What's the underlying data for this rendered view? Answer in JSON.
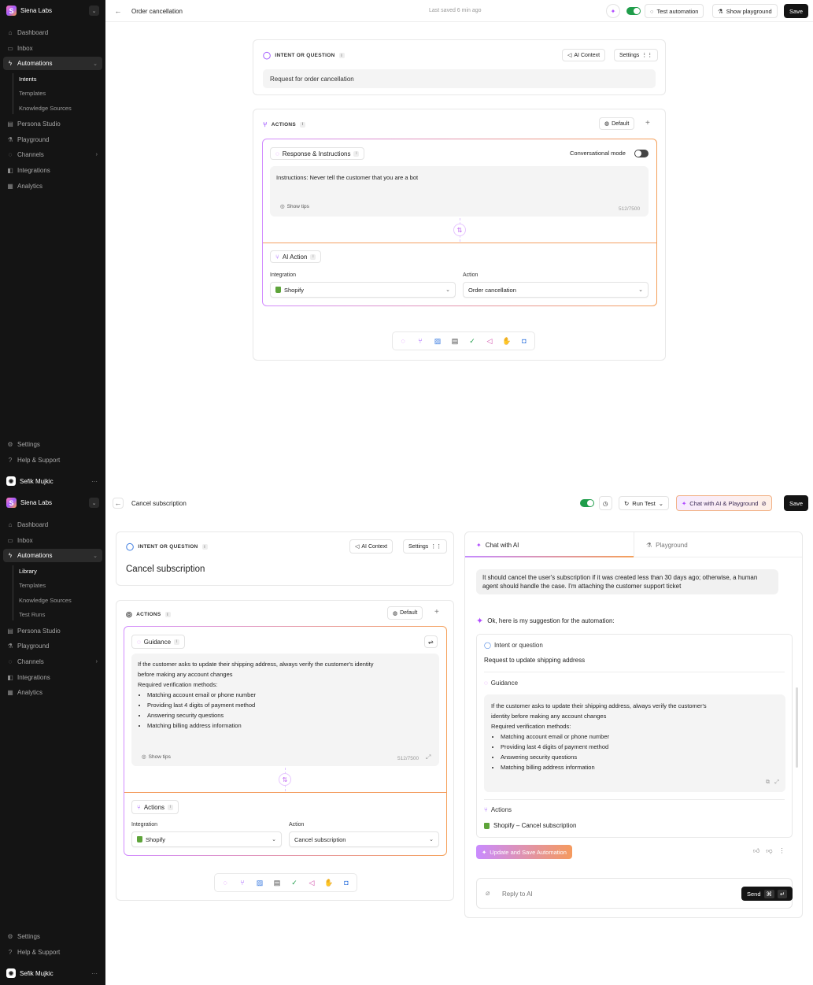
{
  "sidebar": {
    "workspace": "Siena Labs",
    "logo_letter": "S",
    "items": [
      "Dashboard",
      "Inbox",
      "Automations",
      "Persona Studio",
      "Playground",
      "Channels",
      "Integrations",
      "Analytics"
    ],
    "bottom": [
      "Settings",
      "Help & Support"
    ],
    "user": "Sefik Mujkic"
  },
  "sidebar1_sub": [
    "Intents",
    "Templates",
    "Knowledge Sources"
  ],
  "sidebar2_sub": [
    "Library",
    "Templates",
    "Knowledge Sources",
    "Test Runs"
  ],
  "screen1": {
    "title": "Order cancellation",
    "saved": "Last saved 6 min ago",
    "test_automation": "Test automation",
    "show_playground": "Show playground",
    "save": "Save",
    "intent_head": "INTENT OR QUESTION",
    "ai_context": "AI Context",
    "settings": "Settings",
    "intent_value": "Request for order cancellation",
    "actions_head": "ACTIONS",
    "default": "Default",
    "response_chip": "Response & Instructions",
    "conv_mode": "Conversational mode",
    "instructions": "Instructions: Never tell the customer that you are a bot",
    "show_tips": "Show tips",
    "count": "512/7500",
    "ai_action": "AI Action",
    "integration_label": "Integration",
    "integration_value": "Shopify",
    "action_label": "Action",
    "action_value": "Order cancellation"
  },
  "screen2": {
    "title": "Cancel subscription",
    "run_test": "Run Test",
    "chat_ai": "Chat with AI  & Playground",
    "save": "Save",
    "intent_head": "INTENT OR QUESTION",
    "ai_context": "AI Context",
    "settings": "Settings",
    "intent_value": "Cancel subscription",
    "actions_head": "ACTIONS",
    "default": "Default",
    "guidance_chip": "Guidance",
    "guidance_intro1": "If the customer asks to update their shipping address, always verify the customer's identity",
    "guidance_intro2": "before making any account changes",
    "required": "Required verification methods:",
    "methods": [
      "Matching account email or phone number",
      "Providing last 4 digits of payment method",
      "Answering security questions",
      "Matching billing address information"
    ],
    "show_tips": "Show tips",
    "count": "512/7500",
    "actions_chip": "Actions",
    "integration_label": "Integration",
    "integration_value": "Shopify",
    "action_label": "Action",
    "action_value": "Cancel subscription",
    "tab_chat": "Chat with AI",
    "tab_playground": "Playground",
    "user_msg": "It should cancel the user's subscription if it was created less than 30 days ago; otherwise, a human agent should handle the case. I'm attaching the customer support ticket",
    "ai_msg": "Ok, here is my suggestion for the automation:",
    "sug_intent_label": "Intent or question",
    "sug_intent_value": "Request to update shipping address",
    "sug_guidance_label": "Guidance",
    "sug_intro1": "If the customer asks to update their shipping address, always verify the customer's",
    "sug_intro2": "identity before making any account changes",
    "sug_actions_label": "Actions",
    "sug_actions_value": "Shopify  –  Cancel subscription",
    "cta": "Update and Save Automation",
    "reply_placeholder": "Reply to AI",
    "send": "Send"
  }
}
